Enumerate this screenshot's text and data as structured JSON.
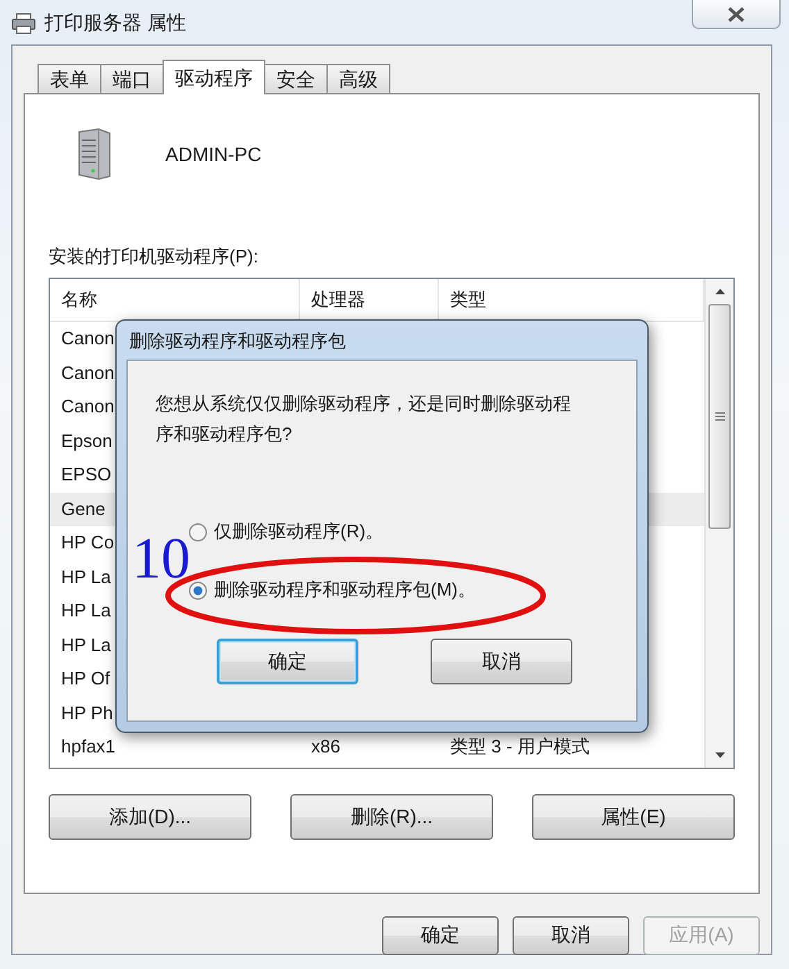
{
  "window": {
    "title": "打印服务器 属性"
  },
  "tabs": [
    {
      "label": "表单",
      "selected": false
    },
    {
      "label": "端口",
      "selected": false
    },
    {
      "label": "驱动程序",
      "selected": true
    },
    {
      "label": "安全",
      "selected": false
    },
    {
      "label": "高级",
      "selected": false
    }
  ],
  "server": {
    "name": "ADMIN-PC"
  },
  "drivers": {
    "label": "安装的打印机驱动程序(P):",
    "columns": [
      "名称",
      "处理器",
      "类型"
    ],
    "rows": [
      {
        "name": "Canon",
        "selected": false
      },
      {
        "name": "Canon",
        "selected": false
      },
      {
        "name": "Canon",
        "selected": false
      },
      {
        "name": "Epson",
        "selected": false
      },
      {
        "name": "EPSO",
        "selected": false
      },
      {
        "name": "Gene",
        "selected": true
      },
      {
        "name": "HP Co",
        "selected": false
      },
      {
        "name": "HP La",
        "selected": false
      },
      {
        "name": "HP La",
        "selected": false
      },
      {
        "name": "HP La",
        "selected": false
      },
      {
        "name": "HP Of",
        "selected": false
      },
      {
        "name": "HP Ph",
        "selected": false
      },
      {
        "name": "hpfax1",
        "processor": "x86",
        "type": "类型 3 - 用户模式",
        "selected": false
      }
    ]
  },
  "actions": [
    "添加(D)...",
    "删除(R)...",
    "属性(E)"
  ],
  "dialog": {
    "title": "删除驱动程序和驱动程序包",
    "message": "您想从系统仅仅删除驱动程序，还是同时删除驱动程序和驱动程序包?",
    "options": [
      {
        "label": "仅删除驱动程序(R)。",
        "selected": false
      },
      {
        "label": "删除驱动程序和驱动程序包(M)。",
        "selected": true
      }
    ],
    "buttons": [
      {
        "label": "确定",
        "default": true
      },
      {
        "label": "取消",
        "default": false
      }
    ]
  },
  "buttons": [
    {
      "label": "确定",
      "disabled": false
    },
    {
      "label": "取消",
      "disabled": false
    },
    {
      "label": "应用(A)",
      "disabled": true
    }
  ],
  "annotation": {
    "step": "10"
  }
}
